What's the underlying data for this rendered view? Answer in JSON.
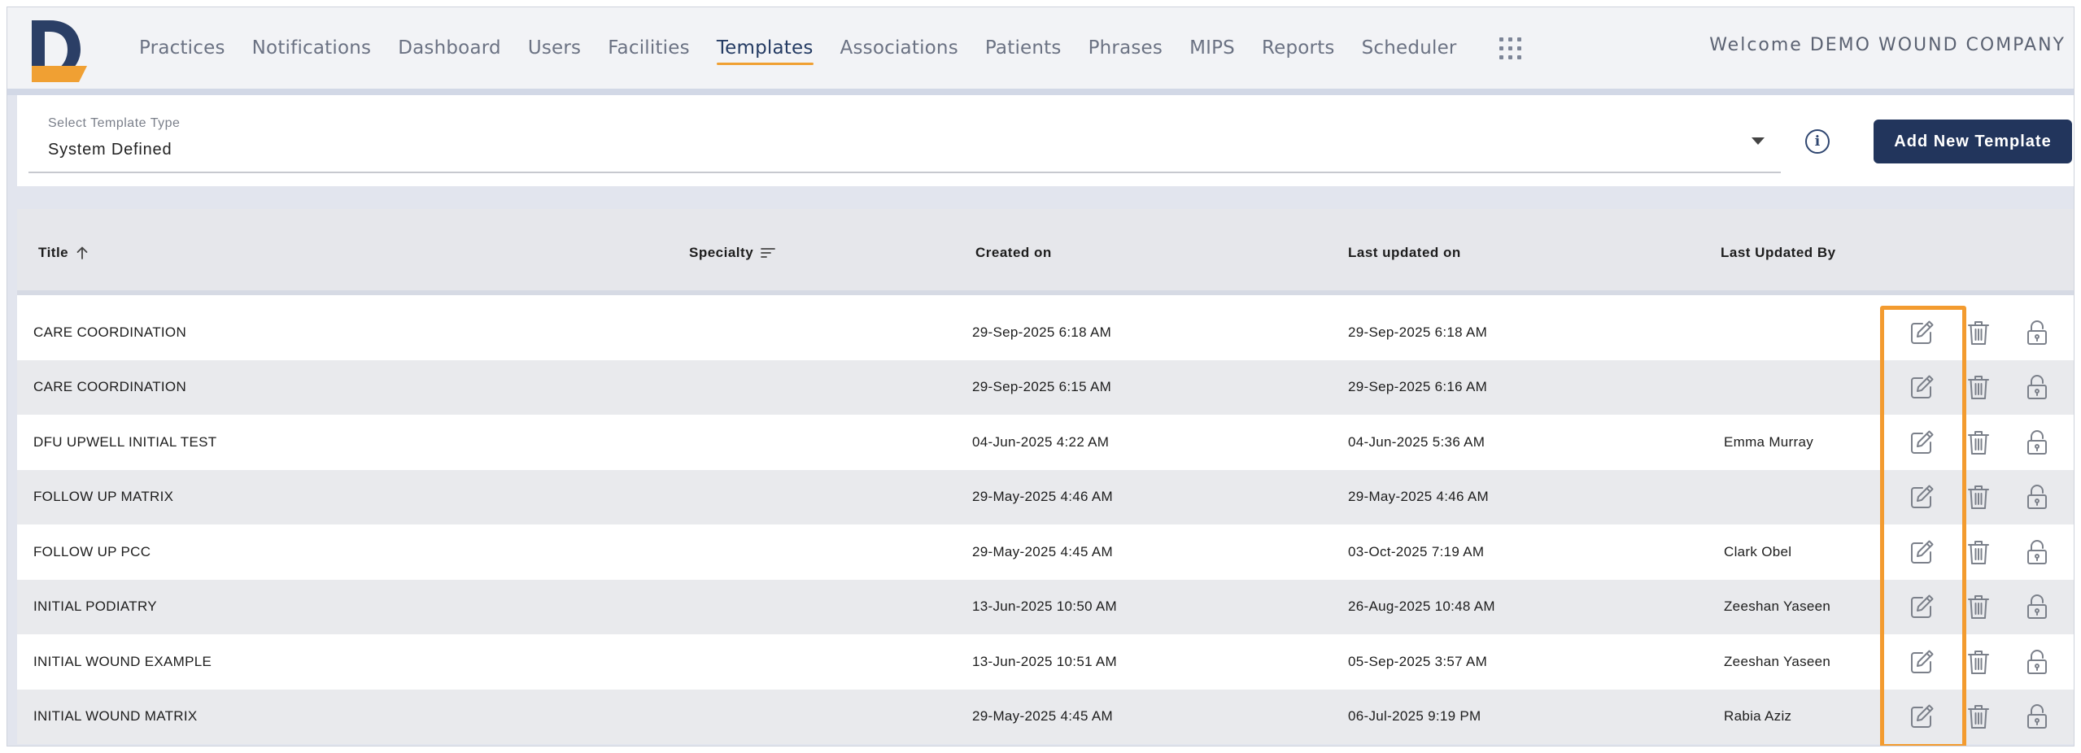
{
  "brand": {
    "logo_letter": "D",
    "logo_navy": "#2b3f66",
    "logo_orange": "#f0a033"
  },
  "nav": {
    "items": [
      "Practices",
      "Notifications",
      "Dashboard",
      "Users",
      "Facilities",
      "Templates",
      "Associations",
      "Patients",
      "Phrases",
      "MIPS",
      "Reports",
      "Scheduler"
    ],
    "active": "Templates",
    "apps_icon": "grid-dots-icon"
  },
  "header": {
    "welcome": "Welcome DEMO WOUND COMPANY"
  },
  "filter": {
    "label": "Select Template Type",
    "value": "System Defined",
    "info_icon": "info-icon",
    "add_button": "Add New Template"
  },
  "table": {
    "columns": {
      "title": "Title",
      "specialty": "Specialty",
      "created": "Created on",
      "updated": "Last updated on",
      "updated_by": "Last Updated By"
    },
    "sort": {
      "column": "Title",
      "direction": "ascending"
    },
    "rows": [
      {
        "title": "CARE COORDINATION",
        "specialty": "",
        "created": "29-Sep-2025 6:18 AM",
        "updated": "29-Sep-2025 6:18 AM",
        "updated_by": ""
      },
      {
        "title": "CARE COORDINATION",
        "specialty": "",
        "created": "29-Sep-2025 6:15 AM",
        "updated": "29-Sep-2025 6:16 AM",
        "updated_by": ""
      },
      {
        "title": "DFU UPWELL INITIAL TEST",
        "specialty": "",
        "created": "04-Jun-2025 4:22 AM",
        "updated": "04-Jun-2025 5:36 AM",
        "updated_by": "Emma Murray"
      },
      {
        "title": "FOLLOW UP MATRIX",
        "specialty": "",
        "created": "29-May-2025 4:46 AM",
        "updated": "29-May-2025 4:46 AM",
        "updated_by": ""
      },
      {
        "title": "FOLLOW UP PCC",
        "specialty": "",
        "created": "29-May-2025 4:45 AM",
        "updated": "03-Oct-2025 7:19 AM",
        "updated_by": "Clark Obel"
      },
      {
        "title": "INITIAL PODIATRY",
        "specialty": "",
        "created": "13-Jun-2025 10:50 AM",
        "updated": "26-Aug-2025 10:48 AM",
        "updated_by": "Zeeshan Yaseen"
      },
      {
        "title": "INITIAL WOUND EXAMPLE",
        "specialty": "",
        "created": "13-Jun-2025 10:51 AM",
        "updated": "05-Sep-2025 3:57 AM",
        "updated_by": "Zeeshan Yaseen"
      },
      {
        "title": "INITIAL WOUND MATRIX",
        "specialty": "",
        "created": "29-May-2025 4:45 AM",
        "updated": "06-Jul-2025 9:19 PM",
        "updated_by": "Rabia Aziz"
      }
    ],
    "action_icons": [
      "edit-icon",
      "trash-icon",
      "lock-icon"
    ]
  },
  "colors": {
    "primary": "#22355c",
    "accent": "#f0a033",
    "highlight": "#f39b2f",
    "header_bg": "#e6e7eb",
    "row_alt": "#e9eaed"
  }
}
